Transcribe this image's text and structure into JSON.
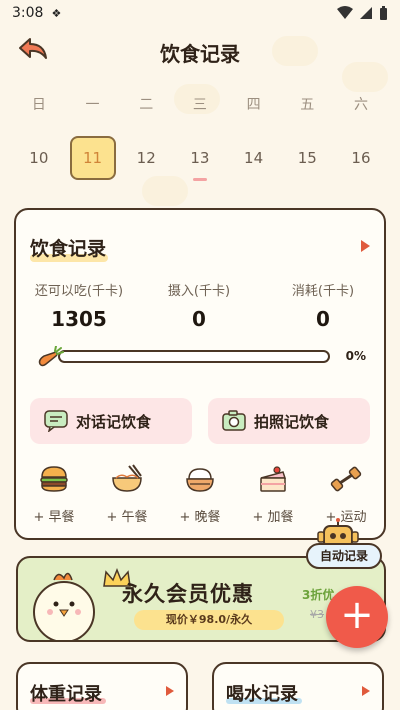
{
  "status_bar": {
    "time": "3:08"
  },
  "header": {
    "title": "饮食记录"
  },
  "week": {
    "weekdays": [
      "日",
      "一",
      "二",
      "三",
      "四",
      "五",
      "六"
    ],
    "dates": [
      "10",
      "11",
      "12",
      "13",
      "14",
      "15",
      "16"
    ],
    "today_index": 1
  },
  "diet_card": {
    "title": "饮食记录",
    "stats": [
      {
        "label": "还可以吃(千卡)",
        "value": "1305"
      },
      {
        "label": "摄入(千卡)",
        "value": "0"
      },
      {
        "label": "消耗(千卡)",
        "value": "0"
      }
    ],
    "progress_percent": "0%",
    "progress_fraction": 0,
    "buttons": {
      "chat_record": "对话记饮食",
      "photo_record": "拍照记饮食"
    },
    "meals": [
      {
        "label": "+ 早餐",
        "icon": "burger-icon"
      },
      {
        "label": "+ 午餐",
        "icon": "noodle-bowl-icon"
      },
      {
        "label": "+ 晚餐",
        "icon": "rice-bowl-icon"
      },
      {
        "label": "+ 加餐",
        "icon": "cake-icon"
      },
      {
        "label": "+ 运动",
        "icon": "dumbbell-icon"
      }
    ]
  },
  "auto_record": {
    "label": "自动记录"
  },
  "banner": {
    "title": "永久会员优惠",
    "price": "现价￥98.0/永久",
    "discount": "3折优",
    "original": "¥3"
  },
  "bottom_cards": {
    "weight": {
      "title": "体重记录"
    },
    "water": {
      "title": "喝水记录"
    }
  },
  "colors": {
    "accent": "#f05a4a",
    "today_bg": "#fce28f",
    "card_border": "#4a3626",
    "banner_bg": "#e4efc7"
  }
}
